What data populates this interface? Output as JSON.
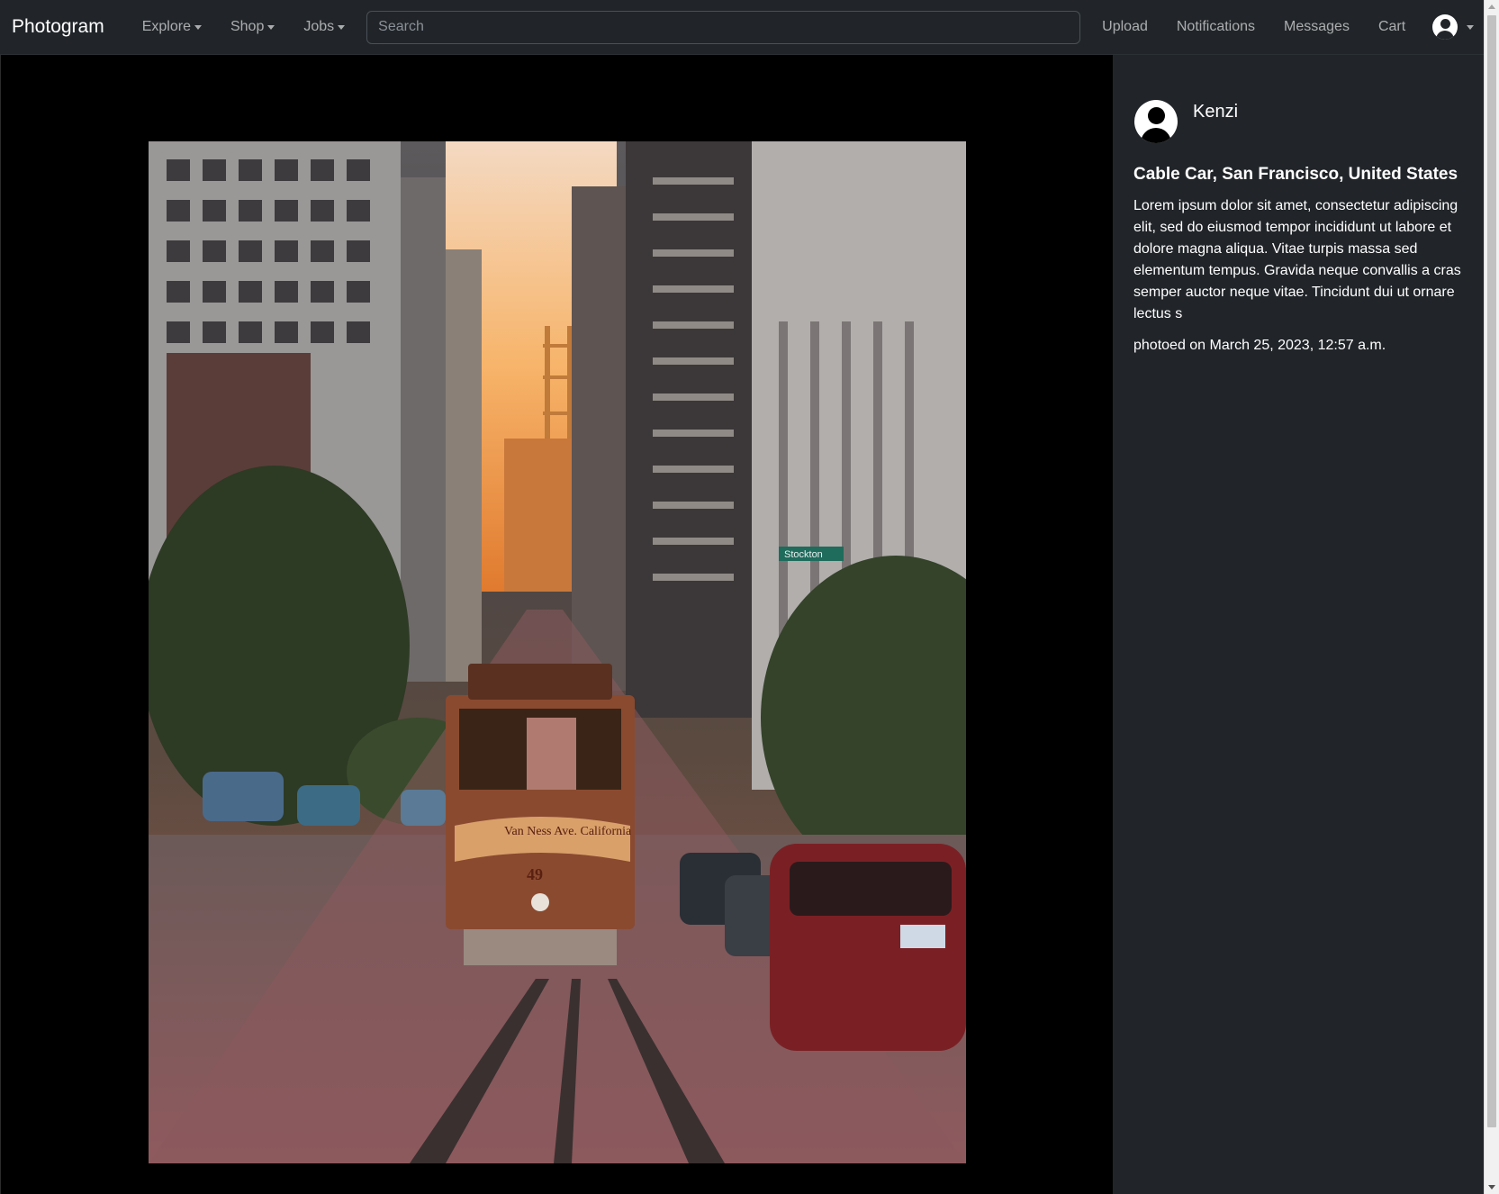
{
  "navbar": {
    "brand": "Photogram",
    "menus": [
      "Explore",
      "Shop",
      "Jobs"
    ],
    "search": {
      "placeholder": "Search",
      "value": ""
    },
    "links": [
      "Upload",
      "Notifications",
      "Messages",
      "Cart"
    ]
  },
  "photo": {
    "alt": "Cable Car, San Francisco, United States",
    "cable_car_sign": "Van Ness Ave. California & Market Streets",
    "car_number": "49",
    "street_sign": "Stockton"
  },
  "post": {
    "author": "Kenzi",
    "title": "Cable Car, San Francisco, United States",
    "description": "Lorem ipsum dolor sit amet, consectetur adipiscing elit, sed do eiusmod tempor incididunt ut labore et dolore magna aliqua. Vitae turpis massa sed elementum tempus. Gravida neque convallis a cras semper auctor neque vitae. Tincidunt dui ut ornare lectus s",
    "date": "photoed on March 25, 2023, 12:57 a.m."
  },
  "colors": {
    "navbar_bg": "#212529",
    "sidebar_bg": "#212529",
    "viewer_bg": "#000000"
  }
}
